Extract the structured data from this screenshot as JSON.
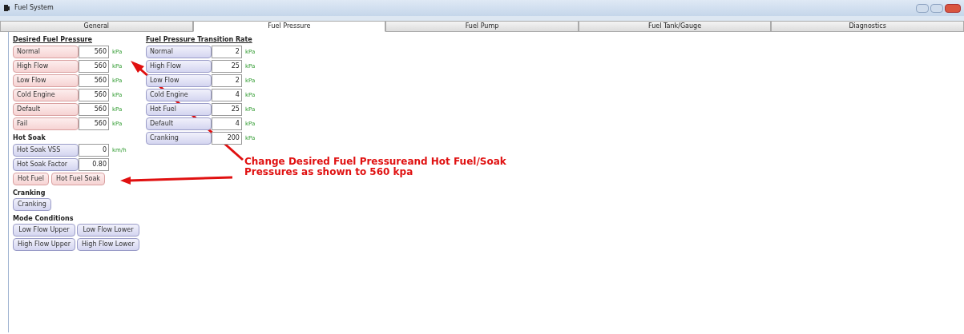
{
  "window": {
    "title": "Fuel System"
  },
  "tabs": [
    {
      "label": "General",
      "selected": false
    },
    {
      "label": "Fuel Pressure",
      "selected": true
    },
    {
      "label": "Fuel Pump",
      "selected": false
    },
    {
      "label": "Fuel Tank/Gauge",
      "selected": false
    },
    {
      "label": "Diagnostics",
      "selected": false
    }
  ],
  "desired_fuel_pressure": {
    "title": "Desired Fuel Pressure",
    "kind": "red",
    "rows": [
      {
        "label": "Normal",
        "value": "560",
        "unit": "kPa"
      },
      {
        "label": "High Flow",
        "value": "560",
        "unit": "kPa"
      },
      {
        "label": "Low Flow",
        "value": "560",
        "unit": "kPa"
      },
      {
        "label": "Cold Engine",
        "value": "560",
        "unit": "kPa"
      },
      {
        "label": "Default",
        "value": "560",
        "unit": "kPa"
      },
      {
        "label": "Fail",
        "value": "560",
        "unit": "kPa"
      }
    ]
  },
  "transition_rate": {
    "title": "Fuel Pressure Transition Rate",
    "kind": "blue",
    "rows": [
      {
        "label": "Normal",
        "value": "2",
        "unit": "kPa"
      },
      {
        "label": "High Flow",
        "value": "25",
        "unit": "kPa"
      },
      {
        "label": "Low Flow",
        "value": "2",
        "unit": "kPa"
      },
      {
        "label": "Cold Engine",
        "value": "4",
        "unit": "kPa"
      },
      {
        "label": "Hot Fuel",
        "value": "25",
        "unit": "kPa"
      },
      {
        "label": "Default",
        "value": "4",
        "unit": "kPa"
      },
      {
        "label": "Cranking",
        "value": "200",
        "unit": "kPa"
      }
    ]
  },
  "hot_soak": {
    "title": "Hot Soak",
    "rows": [
      {
        "label": "Hot Soak VSS",
        "value": "0",
        "unit": "km/h"
      },
      {
        "label": "Hot Soak Factor",
        "value": "0.80"
      }
    ],
    "buttons": [
      {
        "label": "Hot Fuel",
        "kind": "red"
      },
      {
        "label": "Hot Fuel Soak",
        "kind": "red"
      }
    ]
  },
  "cranking": {
    "title": "Cranking",
    "buttons": [
      {
        "label": "Cranking",
        "kind": "blue"
      }
    ]
  },
  "mode_conditions": {
    "title": "Mode Conditions",
    "buttons": [
      {
        "label": "Low Flow Upper",
        "kind": "blue"
      },
      {
        "label": "Low Flow Lower",
        "kind": "blue"
      },
      {
        "label": "High Flow Upper",
        "kind": "blue"
      },
      {
        "label": "High Flow Lower",
        "kind": "blue"
      }
    ]
  },
  "annotation": {
    "lines": [
      "Change Desired Fuel Pressureand Hot Fuel/Soak",
      "Pressures as shown to 560 kpa"
    ]
  }
}
